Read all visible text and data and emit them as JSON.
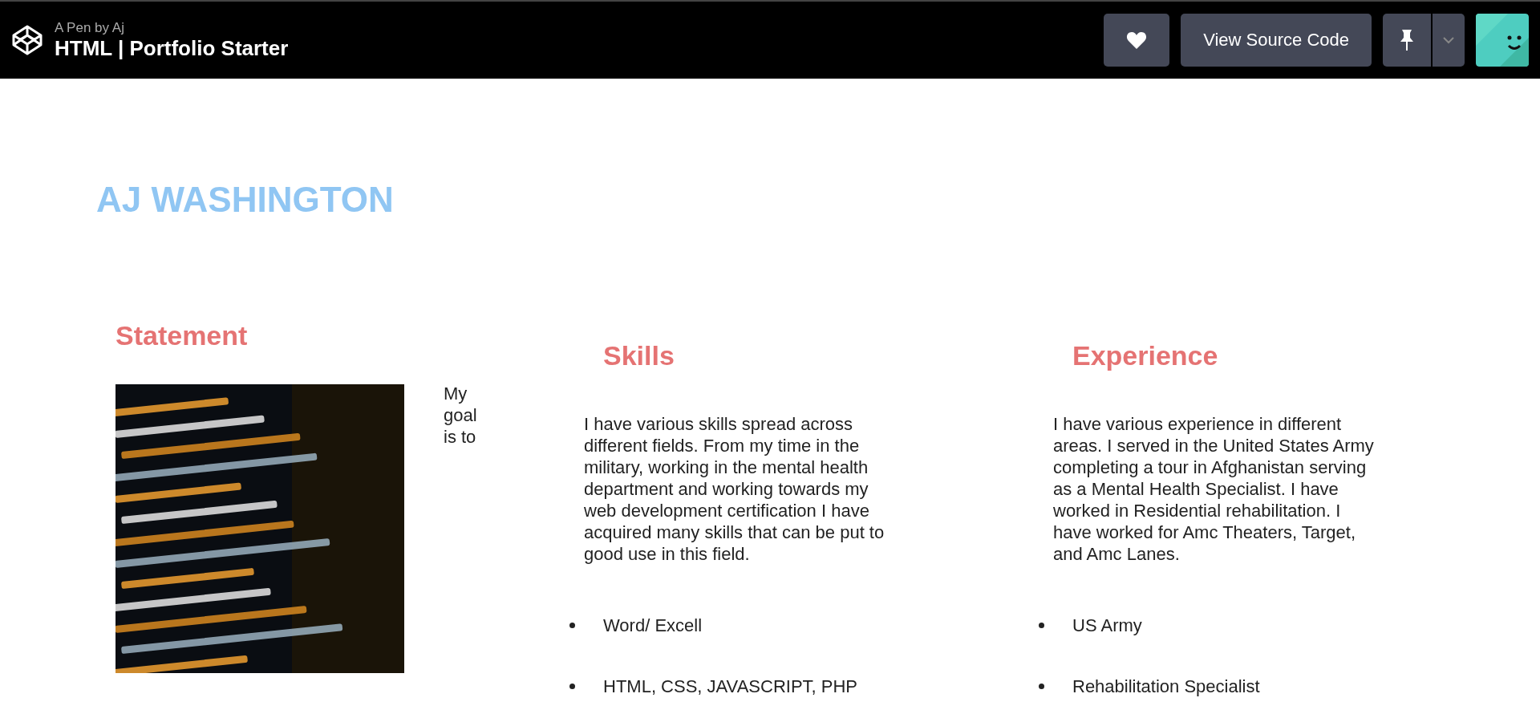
{
  "header": {
    "byline": "A Pen by Aj",
    "title": "HTML | Portfolio Starter",
    "buttons": [
      {
        "kind": "heart"
      },
      {
        "kind": "text",
        "label": "View Source Code"
      },
      {
        "kind": "pin"
      },
      {
        "kind": "caret"
      }
    ]
  },
  "page": {
    "name": "AJ WASHINGTON",
    "sections": [
      {
        "kind": "statement",
        "heading": "Statement",
        "text": "My goal is to"
      },
      {
        "kind": "list",
        "heading": "Skills",
        "text": "I have various skills spread across different fields. From my time in the military, working in the mental health department and working towards my web development certification I have acquired many skills that can be put to good use in this field.",
        "items": [
          "Word/ Excell",
          "HTML, CSS, JAVASCRIPT, PHP"
        ]
      },
      {
        "kind": "list",
        "heading": "Experience",
        "text": "I have various experience in different areas. I served in the United States Army completing a tour in Afghanistan serving as a Mental Health Specialist. I have worked in Residential rehabilitation. I have worked for Amc Theaters, Target, and Amc Lanes.",
        "items": [
          "US Army",
          "Rehabilitation Specialist"
        ]
      }
    ]
  }
}
